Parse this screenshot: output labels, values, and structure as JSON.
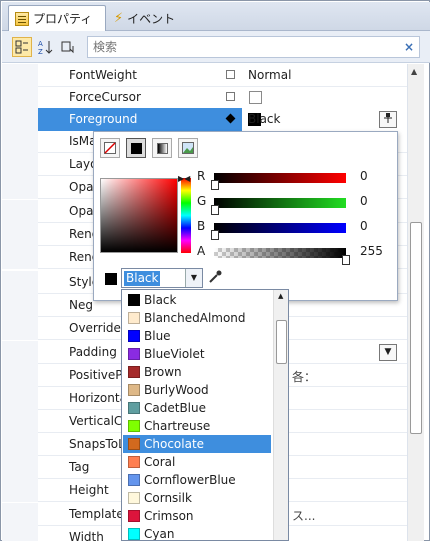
{
  "tabs": {
    "properties": "プロパティ",
    "events": "イベント"
  },
  "toolbar": {
    "search_placeholder": "検索",
    "clear": "×"
  },
  "rows": [
    {
      "name": "FontWeight",
      "value": "Normal"
    },
    {
      "name": "ForceCursor",
      "value": ""
    },
    {
      "name": "Foreground",
      "value": "Black"
    },
    {
      "name": "IsMa"
    },
    {
      "name": "Layo"
    },
    {
      "name": "Opac"
    },
    {
      "name": "Opac"
    },
    {
      "name": "Reno"
    },
    {
      "name": "Reno"
    },
    {
      "name": "Style"
    },
    {
      "name": "Neg"
    },
    {
      "name": "Overrides"
    },
    {
      "name": "Padding"
    },
    {
      "name": "PositiveP",
      "value": "各："
    },
    {
      "name": "Horizonta"
    },
    {
      "name": "VerticalC"
    },
    {
      "name": "SnapsToL"
    },
    {
      "name": "Tag"
    },
    {
      "name": "Height"
    },
    {
      "name": "Template",
      "value": "ス..."
    },
    {
      "name": "Width"
    }
  ],
  "picker": {
    "labels": {
      "r": "R",
      "g": "G",
      "b": "B",
      "a": "A"
    },
    "values": {
      "r": "0",
      "g": "0",
      "b": "0",
      "a": "255"
    },
    "current": "Black",
    "colors": {
      "r": "#ff0000",
      "g": "#22dd22",
      "b": "#0000ff"
    }
  },
  "colorlist": [
    {
      "name": "Black",
      "color": "#000000"
    },
    {
      "name": "BlanchedAlmond",
      "color": "#ffebcd"
    },
    {
      "name": "Blue",
      "color": "#0000ff"
    },
    {
      "name": "BlueViolet",
      "color": "#8a2be2"
    },
    {
      "name": "Brown",
      "color": "#a52a2a"
    },
    {
      "name": "BurlyWood",
      "color": "#deb887"
    },
    {
      "name": "CadetBlue",
      "color": "#5f9ea0"
    },
    {
      "name": "Chartreuse",
      "color": "#7fff00"
    },
    {
      "name": "Chocolate",
      "color": "#d2691e",
      "selected": true
    },
    {
      "name": "Coral",
      "color": "#ff7f50"
    },
    {
      "name": "CornflowerBlue",
      "color": "#6495ed"
    },
    {
      "name": "Cornsilk",
      "color": "#fff8dc"
    },
    {
      "name": "Crimson",
      "color": "#dc143c"
    },
    {
      "name": "Cyan",
      "color": "#00ffff"
    }
  ]
}
